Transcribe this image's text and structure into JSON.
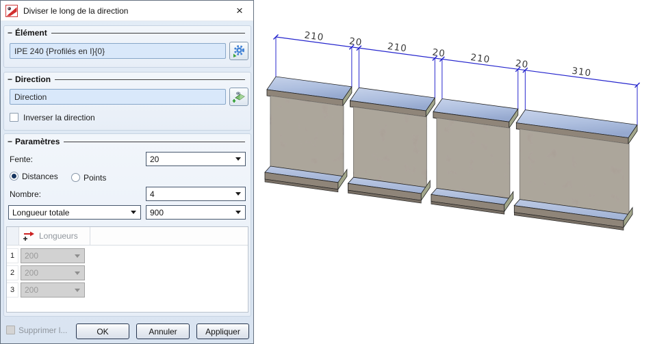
{
  "dialog": {
    "title": "Diviser le long de la direction",
    "close_glyph": "×",
    "sections": {
      "element": {
        "header": "Élément",
        "value": "IPE 240 {Profilés en I}{0}"
      },
      "direction": {
        "header": "Direction",
        "value": "Direction",
        "invert_label": "Inverser la direction"
      },
      "parametres": {
        "header": "Paramètres",
        "fente_label": "Fente:",
        "fente_value": "20",
        "radio_distances": "Distances",
        "radio_points": "Points",
        "nombre_label": "Nombre:",
        "nombre_value": "4",
        "mode_value": "Longueur totale",
        "total_value": "900",
        "table": {
          "header": "Longueurs",
          "rows": [
            {
              "index": "1",
              "value": "200"
            },
            {
              "index": "2",
              "value": "200"
            },
            {
              "index": "3",
              "value": "200"
            }
          ]
        }
      }
    },
    "footer": {
      "supprimer_label": "Supprimer l...",
      "ok": "OK",
      "annuler": "Annuler",
      "appliquer": "Appliquer"
    }
  },
  "viewport": {
    "dimension_values": [
      "210",
      "20",
      "210",
      "20",
      "210",
      "20",
      "310"
    ],
    "dimension_color": "#2424cd",
    "dim_label_color": "#3a3a3a"
  }
}
